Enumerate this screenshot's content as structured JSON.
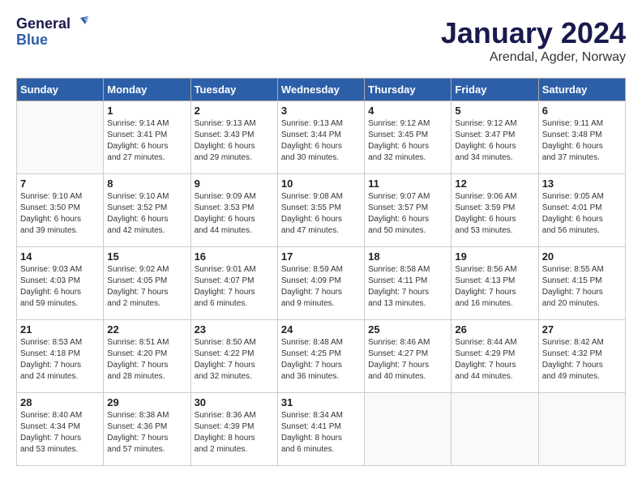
{
  "header": {
    "logo_line1": "General",
    "logo_line2": "Blue",
    "month": "January 2024",
    "location": "Arendal, Agder, Norway"
  },
  "weekdays": [
    "Sunday",
    "Monday",
    "Tuesday",
    "Wednesday",
    "Thursday",
    "Friday",
    "Saturday"
  ],
  "weeks": [
    [
      {
        "day": "",
        "info": ""
      },
      {
        "day": "1",
        "info": "Sunrise: 9:14 AM\nSunset: 3:41 PM\nDaylight: 6 hours\nand 27 minutes."
      },
      {
        "day": "2",
        "info": "Sunrise: 9:13 AM\nSunset: 3:43 PM\nDaylight: 6 hours\nand 29 minutes."
      },
      {
        "day": "3",
        "info": "Sunrise: 9:13 AM\nSunset: 3:44 PM\nDaylight: 6 hours\nand 30 minutes."
      },
      {
        "day": "4",
        "info": "Sunrise: 9:12 AM\nSunset: 3:45 PM\nDaylight: 6 hours\nand 32 minutes."
      },
      {
        "day": "5",
        "info": "Sunrise: 9:12 AM\nSunset: 3:47 PM\nDaylight: 6 hours\nand 34 minutes."
      },
      {
        "day": "6",
        "info": "Sunrise: 9:11 AM\nSunset: 3:48 PM\nDaylight: 6 hours\nand 37 minutes."
      }
    ],
    [
      {
        "day": "7",
        "info": "Sunrise: 9:10 AM\nSunset: 3:50 PM\nDaylight: 6 hours\nand 39 minutes."
      },
      {
        "day": "8",
        "info": "Sunrise: 9:10 AM\nSunset: 3:52 PM\nDaylight: 6 hours\nand 42 minutes."
      },
      {
        "day": "9",
        "info": "Sunrise: 9:09 AM\nSunset: 3:53 PM\nDaylight: 6 hours\nand 44 minutes."
      },
      {
        "day": "10",
        "info": "Sunrise: 9:08 AM\nSunset: 3:55 PM\nDaylight: 6 hours\nand 47 minutes."
      },
      {
        "day": "11",
        "info": "Sunrise: 9:07 AM\nSunset: 3:57 PM\nDaylight: 6 hours\nand 50 minutes."
      },
      {
        "day": "12",
        "info": "Sunrise: 9:06 AM\nSunset: 3:59 PM\nDaylight: 6 hours\nand 53 minutes."
      },
      {
        "day": "13",
        "info": "Sunrise: 9:05 AM\nSunset: 4:01 PM\nDaylight: 6 hours\nand 56 minutes."
      }
    ],
    [
      {
        "day": "14",
        "info": "Sunrise: 9:03 AM\nSunset: 4:03 PM\nDaylight: 6 hours\nand 59 minutes."
      },
      {
        "day": "15",
        "info": "Sunrise: 9:02 AM\nSunset: 4:05 PM\nDaylight: 7 hours\nand 2 minutes."
      },
      {
        "day": "16",
        "info": "Sunrise: 9:01 AM\nSunset: 4:07 PM\nDaylight: 7 hours\nand 6 minutes."
      },
      {
        "day": "17",
        "info": "Sunrise: 8:59 AM\nSunset: 4:09 PM\nDaylight: 7 hours\nand 9 minutes."
      },
      {
        "day": "18",
        "info": "Sunrise: 8:58 AM\nSunset: 4:11 PM\nDaylight: 7 hours\nand 13 minutes."
      },
      {
        "day": "19",
        "info": "Sunrise: 8:56 AM\nSunset: 4:13 PM\nDaylight: 7 hours\nand 16 minutes."
      },
      {
        "day": "20",
        "info": "Sunrise: 8:55 AM\nSunset: 4:15 PM\nDaylight: 7 hours\nand 20 minutes."
      }
    ],
    [
      {
        "day": "21",
        "info": "Sunrise: 8:53 AM\nSunset: 4:18 PM\nDaylight: 7 hours\nand 24 minutes."
      },
      {
        "day": "22",
        "info": "Sunrise: 8:51 AM\nSunset: 4:20 PM\nDaylight: 7 hours\nand 28 minutes."
      },
      {
        "day": "23",
        "info": "Sunrise: 8:50 AM\nSunset: 4:22 PM\nDaylight: 7 hours\nand 32 minutes."
      },
      {
        "day": "24",
        "info": "Sunrise: 8:48 AM\nSunset: 4:25 PM\nDaylight: 7 hours\nand 36 minutes."
      },
      {
        "day": "25",
        "info": "Sunrise: 8:46 AM\nSunset: 4:27 PM\nDaylight: 7 hours\nand 40 minutes."
      },
      {
        "day": "26",
        "info": "Sunrise: 8:44 AM\nSunset: 4:29 PM\nDaylight: 7 hours\nand 44 minutes."
      },
      {
        "day": "27",
        "info": "Sunrise: 8:42 AM\nSunset: 4:32 PM\nDaylight: 7 hours\nand 49 minutes."
      }
    ],
    [
      {
        "day": "28",
        "info": "Sunrise: 8:40 AM\nSunset: 4:34 PM\nDaylight: 7 hours\nand 53 minutes."
      },
      {
        "day": "29",
        "info": "Sunrise: 8:38 AM\nSunset: 4:36 PM\nDaylight: 7 hours\nand 57 minutes."
      },
      {
        "day": "30",
        "info": "Sunrise: 8:36 AM\nSunset: 4:39 PM\nDaylight: 8 hours\nand 2 minutes."
      },
      {
        "day": "31",
        "info": "Sunrise: 8:34 AM\nSunset: 4:41 PM\nDaylight: 8 hours\nand 6 minutes."
      },
      {
        "day": "",
        "info": ""
      },
      {
        "day": "",
        "info": ""
      },
      {
        "day": "",
        "info": ""
      }
    ]
  ]
}
